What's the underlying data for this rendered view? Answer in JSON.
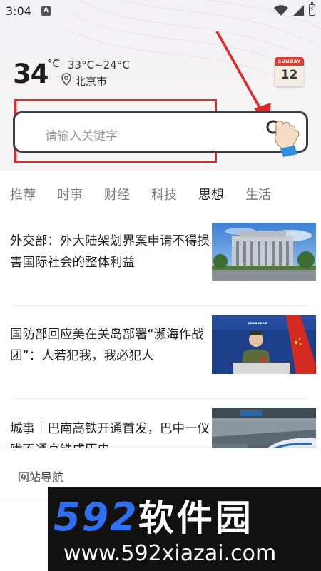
{
  "status_bar": {
    "time": "3:04",
    "notification_icon": "A"
  },
  "weather": {
    "temperature": "34",
    "unit": "°C",
    "range": "33°C~24°C",
    "city": "北京市"
  },
  "calendar": {
    "weekday": "SUNDAY",
    "day": "12"
  },
  "search": {
    "placeholder": "请输入关键字"
  },
  "tabs": [
    {
      "label": "推荐",
      "active": false
    },
    {
      "label": "时事",
      "active": false
    },
    {
      "label": "财经",
      "active": false
    },
    {
      "label": "科技",
      "active": false
    },
    {
      "label": "思想",
      "active": true
    },
    {
      "label": "生活",
      "active": false
    }
  ],
  "news": [
    {
      "title": "外交部：外大陆架划界案申请不得损害国际社会的整体利益"
    },
    {
      "title": "国防部回应美在关岛部署“濒海作战团”：人若犯我，我必犯人"
    },
    {
      "title": "城事｜巴南高铁开通首发，巴中一仪陇不通高铁成历史"
    }
  ],
  "site_nav": {
    "title": "网站导航"
  },
  "watermark": {
    "brand_number": "592",
    "brand_name": "软件园",
    "url": "www.592xiazai.com"
  },
  "colors": {
    "accent_red": "#e0282b",
    "watermark_blue": "#2f6ff0",
    "search_border": "#3a3f45"
  }
}
